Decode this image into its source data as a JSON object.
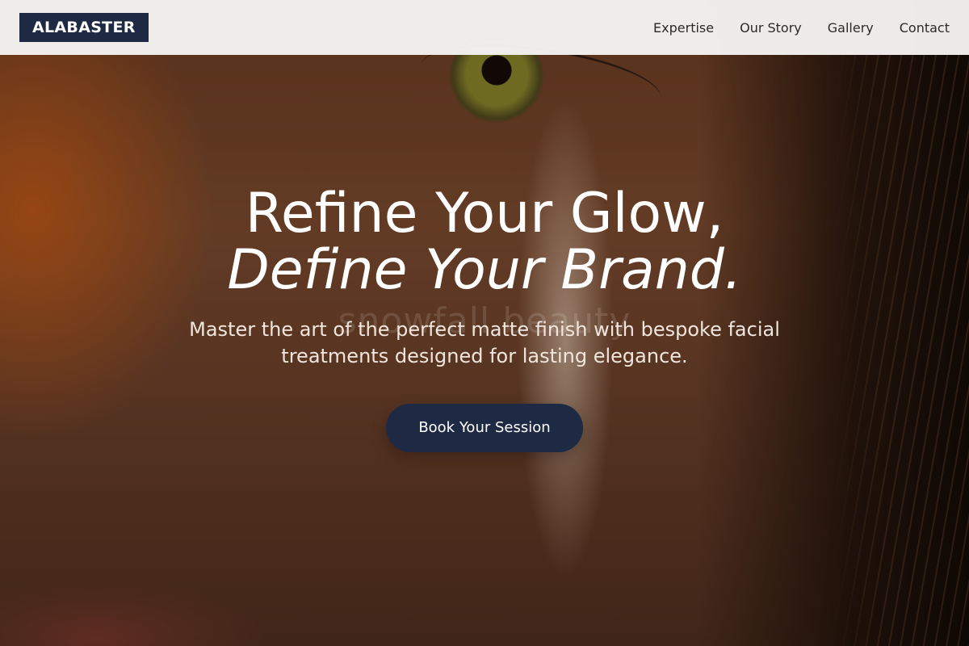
{
  "brand": {
    "logo_text": "ALABASTER",
    "accent_color": "#1e2a44"
  },
  "nav": {
    "items": [
      {
        "label": "Expertise"
      },
      {
        "label": "Our Story"
      },
      {
        "label": "Gallery"
      },
      {
        "label": "Contact"
      }
    ]
  },
  "hero": {
    "headline_line1": "Refine Your Glow,",
    "headline_line2": "Define Your Brand.",
    "watermark": "snowfall beauty",
    "subtitle": "Master the art of the perfect matte finish with bespoke facial treatments designed for lasting elegance.",
    "cta_label": "Book Your Session"
  }
}
